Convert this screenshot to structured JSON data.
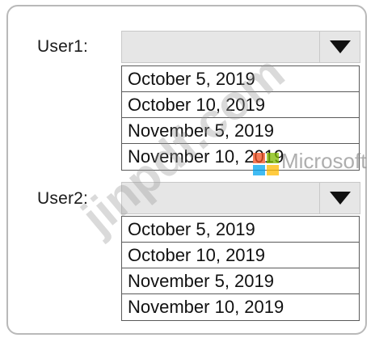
{
  "user1": {
    "label": "User1:",
    "selected": "",
    "options": [
      "October 5, 2019",
      "October 10, 2019",
      "November 5, 2019",
      "November 10, 2019"
    ]
  },
  "user2": {
    "label": "User2:",
    "selected": "",
    "options": [
      "October 5, 2019",
      "October 10, 2019",
      "November 5, 2019",
      "November 10, 2019"
    ]
  },
  "watermark": {
    "text": "jinpdf.com",
    "brand": "Microsoft"
  },
  "colors": {
    "logo_red": "#f25022",
    "logo_green": "#7fba00",
    "logo_blue": "#00a4ef",
    "logo_yellow": "#ffb900",
    "accent_dash": "#5fae5f"
  },
  "icons": {
    "dropdown": "chevron-down-icon"
  }
}
